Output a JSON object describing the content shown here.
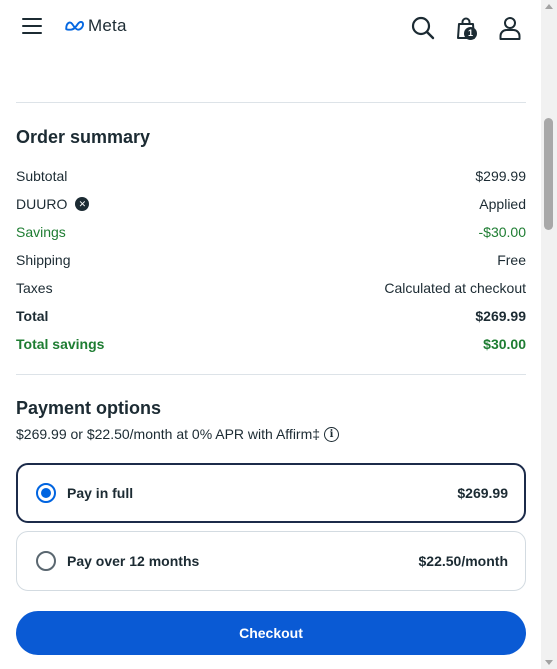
{
  "header": {
    "brand": "Meta",
    "cart_count": "1",
    "icons": [
      "menu-icon",
      "meta-logo-icon",
      "search-icon",
      "shopping-bag-icon",
      "user-icon"
    ]
  },
  "order_summary": {
    "title": "Order summary",
    "rows": [
      {
        "label": "Subtotal",
        "value": "$299.99"
      },
      {
        "label": "DUURO",
        "value": "Applied"
      },
      {
        "label": "Savings",
        "value": "-$30.00"
      },
      {
        "label": "Shipping",
        "value": "Free"
      },
      {
        "label": "Taxes",
        "value": "Calculated at checkout"
      },
      {
        "label": "Total",
        "value": "$269.99"
      },
      {
        "label": "Total savings",
        "value": "$30.00"
      }
    ],
    "promo_remove_glyph": "✕"
  },
  "payment": {
    "title": "Payment options",
    "affirm_text": "$269.99 or $22.50/month at 0% APR with Affirm‡",
    "info_glyph": "i",
    "options": [
      {
        "label": "Pay in full",
        "price": "$269.99",
        "selected": true
      },
      {
        "label": "Pay over 12 months",
        "price": "$22.50/month",
        "selected": false
      }
    ]
  },
  "checkout": {
    "label": "Checkout"
  },
  "colors": {
    "accent": "#0a5ad4",
    "savings_green": "#1e7d32",
    "text": "#1c2b33"
  }
}
